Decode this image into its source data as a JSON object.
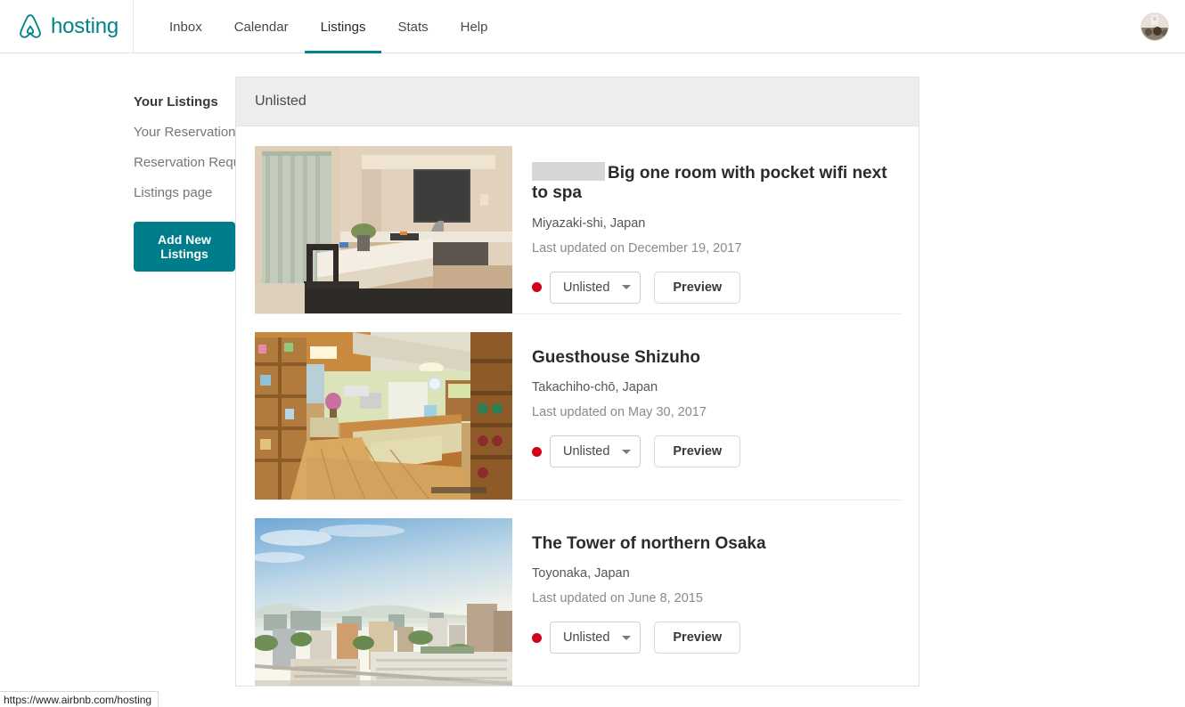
{
  "browser": {
    "status_url": "https://www.airbnb.com/hosting"
  },
  "topbar": {
    "brand_word": "hosting",
    "brand_logo_icon": "airbnb-belo-icon",
    "accent_color": "#008489",
    "nav": [
      {
        "label": "Inbox",
        "active": false
      },
      {
        "label": "Calendar",
        "active": false
      },
      {
        "label": "Listings",
        "active": true
      },
      {
        "label": "Stats",
        "active": false
      },
      {
        "label": "Help",
        "active": false
      }
    ],
    "avatar_alt": "user-avatar"
  },
  "sidebar": {
    "items": [
      {
        "label": "Your Listings",
        "current": true
      },
      {
        "label": "Your Reservations",
        "current": false
      },
      {
        "label": "Reservation Requirements",
        "current": false
      },
      {
        "label": "Listings page",
        "current": false
      }
    ],
    "add_button_label": "Add New Listings",
    "add_button_color": "#007d8a"
  },
  "panel": {
    "section_header": "Unlisted",
    "status_dot_color": "#d0021b",
    "listings": [
      {
        "title": "Big one room with pocket wifi next to spa",
        "title_redacted_prefix": true,
        "location": "Miyazaki-shi, Japan",
        "updated": "Last updated on December 19, 2017",
        "status": "Unlisted",
        "preview_label": "Preview",
        "photo_alt": "apartment-kitchen-counter-photo"
      },
      {
        "title": "Guesthouse Shizuho",
        "title_redacted_prefix": false,
        "location": "Takachiho-chō, Japan",
        "updated": "Last updated on May 30, 2017",
        "status": "Unlisted",
        "preview_label": "Preview",
        "photo_alt": "guesthouse-interior-photo"
      },
      {
        "title": "The Tower of northern Osaka",
        "title_redacted_prefix": false,
        "location": "Toyonaka, Japan",
        "updated": "Last updated on June 8, 2015",
        "status": "Unlisted",
        "preview_label": "Preview",
        "photo_alt": "city-skyline-view-photo"
      }
    ]
  }
}
